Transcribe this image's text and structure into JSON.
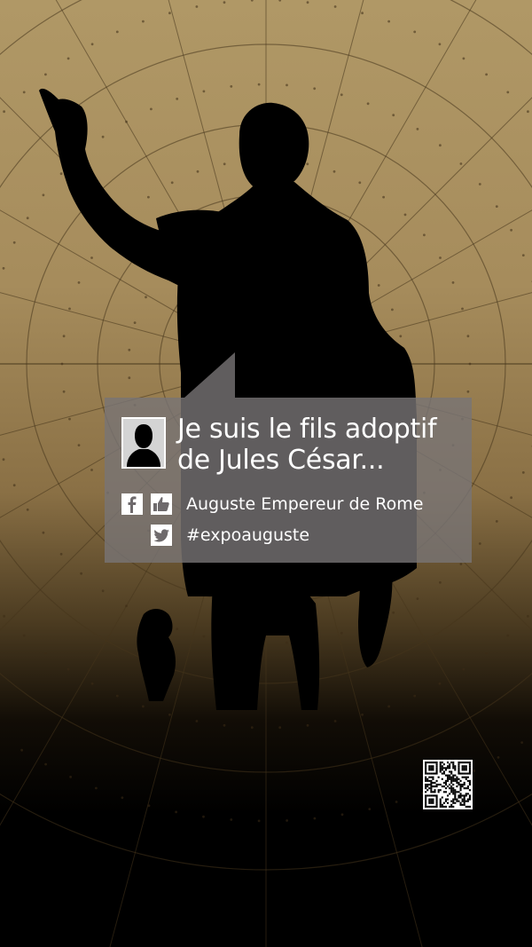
{
  "quote": {
    "line1": "Je suis le fils adoptif",
    "line2": "de Jules César..."
  },
  "social": {
    "facebook_page": "Auguste Empereur de Rome",
    "twitter_hashtag": "#expoauguste"
  },
  "icons": {
    "avatar": "person-silhouette-icon",
    "facebook": "facebook-icon",
    "like": "thumbs-up-icon",
    "twitter": "twitter-bird-icon",
    "qr": "qr-code"
  },
  "colors": {
    "gold": "#a68c5c",
    "black": "#000000",
    "bubble": "#78767a",
    "text": "#ffffff"
  }
}
